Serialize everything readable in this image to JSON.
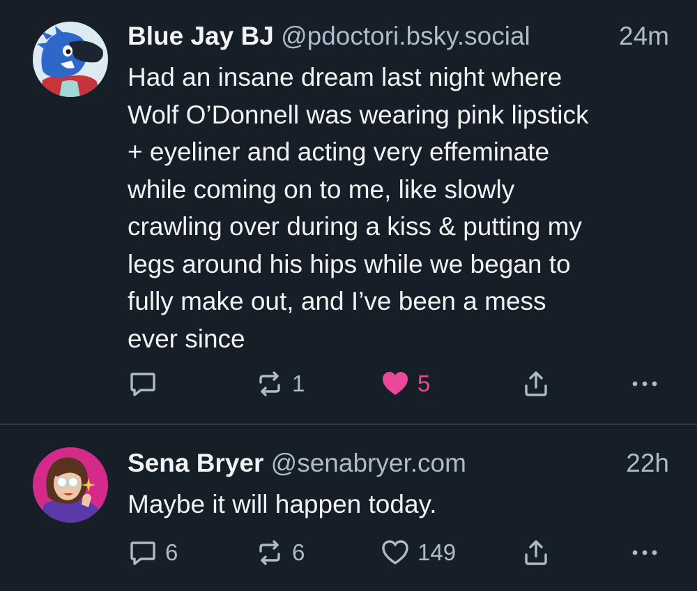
{
  "posts": [
    {
      "author": {
        "display_name": "Blue Jay BJ",
        "handle": "@pdoctori.bsky.social"
      },
      "time": "24m",
      "text_lines": [
        "Had an insane dream last night where",
        "Wolf O’Donnell was wearing pink lipstick",
        "+ eyeliner and acting very effeminate",
        "while coming on to me, like slowly",
        "crawling over during a kiss & putting my",
        "legs around his hips while we began to",
        "fully make out, and I’ve been a mess",
        "ever since"
      ],
      "actions": {
        "reply_count": "",
        "repost_count": "1",
        "like_count": "5",
        "liked": true
      }
    },
    {
      "author": {
        "display_name": "Sena Bryer",
        "handle": "@senabryer.com"
      },
      "time": "22h",
      "text_lines": [
        "Maybe it will happen today."
      ],
      "actions": {
        "reply_count": "6",
        "repost_count": "6",
        "like_count": "149",
        "liked": false
      }
    }
  ],
  "icons": {
    "reply": "reply-icon",
    "repost": "repost-icon",
    "like": "heart-icon",
    "share": "share-icon",
    "more": "more-icon"
  },
  "colors": {
    "background": "#161e27",
    "text": "#f1f3f5",
    "muted": "#aebbc9",
    "like": "#ec4899",
    "divider": "#2c3845"
  }
}
